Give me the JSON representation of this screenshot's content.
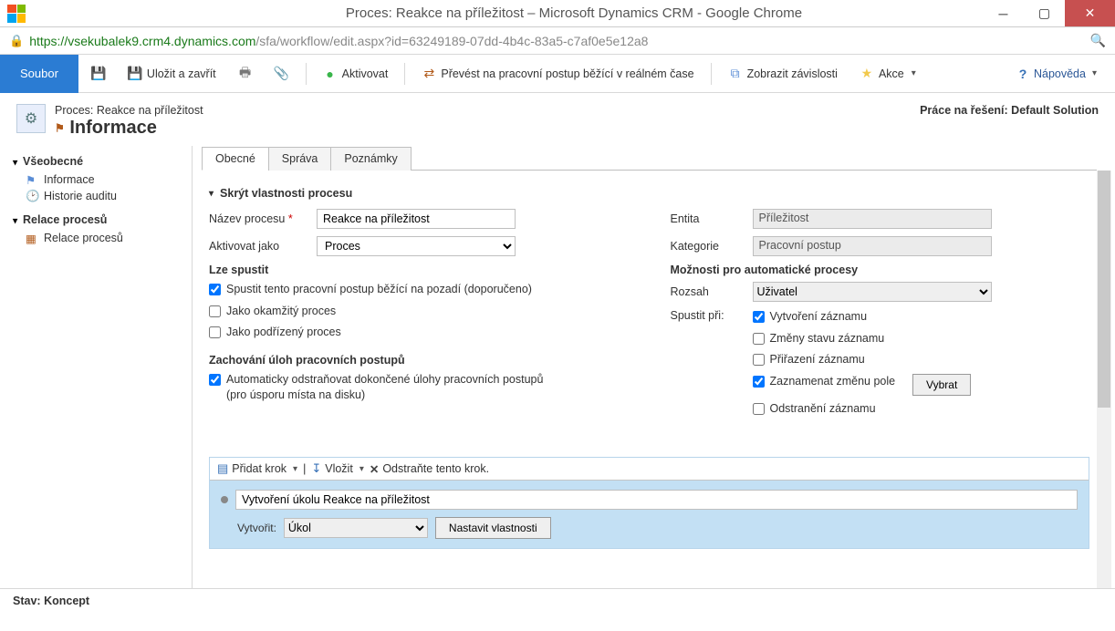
{
  "window": {
    "title": "Proces: Reakce na příležitost – Microsoft Dynamics CRM - Google Chrome"
  },
  "url": {
    "green": "https://vsekubalek9.crm4.dynamics.com",
    "grey": "/sfa/workflow/edit.aspx?id=63249189-07dd-4b4c-83a5-c7af0e5e12a8"
  },
  "ribbon": {
    "file": "Soubor",
    "saveClose": "Uložit a zavřít",
    "activate": "Aktivovat",
    "convert": "Převést na pracovní postup běžící v reálném čase",
    "deps": "Zobrazit závislosti",
    "actions": "Akce",
    "help": "Nápověda"
  },
  "header": {
    "breadcrumb": "Proces: Reakce na příležitost",
    "title": "Informace",
    "solutionLabel": "Práce na řešení:",
    "solutionName": "Default Solution"
  },
  "nav": {
    "group1": "Všeobecné",
    "item1": "Informace",
    "item2": "Historie auditu",
    "group2": "Relace procesů",
    "item3": "Relace procesů"
  },
  "tabs": {
    "t1": "Obecné",
    "t2": "Správa",
    "t3": "Poznámky"
  },
  "form": {
    "section": "Skrýt vlastnosti procesu",
    "nameLabel": "Název procesu",
    "nameValue": "Reakce na příležitost",
    "activateAsLabel": "Aktivovat jako",
    "activateAsValue": "Proces",
    "canRun": "Lze spustit",
    "runBg": "Spustit tento pracovní postup běžící na pozadí (doporučeno)",
    "runImmediate": "Jako okamžitý proces",
    "runChild": "Jako podřízený proces",
    "retain": "Zachování úloh pracovních postupů",
    "retainChk": "Automaticky odstraňovat dokončené úlohy pracovních postupů (pro úsporu místa na disku)",
    "entityLabel": "Entita",
    "entityValue": "Příležitost",
    "categoryLabel": "Kategorie",
    "categoryValue": "Pracovní postup",
    "autoHdr": "Možnosti pro automatické procesy",
    "scopeLabel": "Rozsah",
    "scopeValue": "Uživatel",
    "triggerLabel": "Spustit při:",
    "trgCreate": "Vytvoření záznamu",
    "trgStatus": "Změny stavu záznamu",
    "trgAssign": "Přiřazení záznamu",
    "trgField": "Zaznamenat změnu pole",
    "trgDelete": "Odstranění záznamu",
    "selectBtn": "Vybrat"
  },
  "steps": {
    "add": "Přidat krok",
    "insert": "Vložit",
    "delete": "Odstraňte tento krok.",
    "desc": "Vytvoření úkolu Reakce na příležitost",
    "createLabel": "Vytvořit:",
    "createValue": "Úkol",
    "propsBtn": "Nastavit vlastnosti"
  },
  "status": {
    "label": "Stav:",
    "value": "Koncept"
  }
}
